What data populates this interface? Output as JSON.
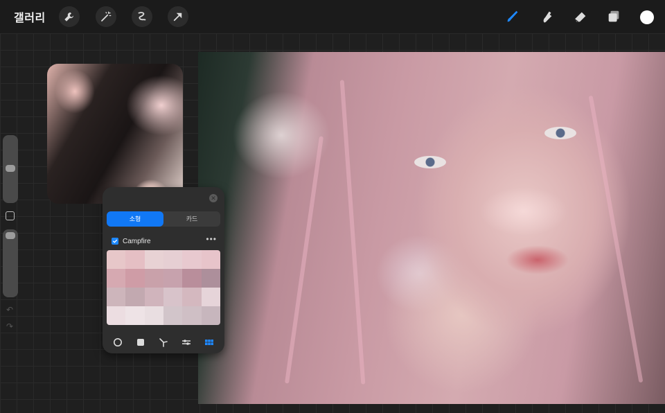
{
  "topbar": {
    "gallery_label": "갤러리",
    "left_tools": [
      "wrench-icon",
      "magic-wand-icon",
      "selection-icon",
      "transform-arrow-icon"
    ],
    "right_tools": [
      "brush-icon",
      "smudge-icon",
      "eraser-icon",
      "layers-icon"
    ],
    "active_color": "#ffffff",
    "brush_accent": "#1e88ff"
  },
  "palette_panel": {
    "tabs": [
      {
        "label": "소형",
        "active": true
      },
      {
        "label": "카드",
        "active": false
      }
    ],
    "palette_name": "Campfire",
    "more": "•••",
    "swatches": [
      "#e7c7c9",
      "#e5bfc4",
      "#e8d2d4",
      "#e6cfd3",
      "#e8c9cf",
      "#e7c4ca",
      "#d6a9b1",
      "#cf9ca6",
      "#c9a1aa",
      "#c7a2ad",
      "#b98e9b",
      "#ad8f9b",
      "#cdb5bb",
      "#c2a9b0",
      "#d0b4bc",
      "#d8c3ca",
      "#d4b8bf",
      "#e6d4d9",
      "#ecdde1",
      "#eee3e6",
      "#e9dee1",
      "#d2c5ca",
      "#cfbfc5",
      "#c7b6bd"
    ],
    "bottom_modes": [
      "disc-icon",
      "classic-icon",
      "harmony-icon",
      "value-sliders-icon",
      "palettes-grid-icon"
    ],
    "active_mode": "palettes-grid-icon",
    "accent": "#1178f5"
  }
}
